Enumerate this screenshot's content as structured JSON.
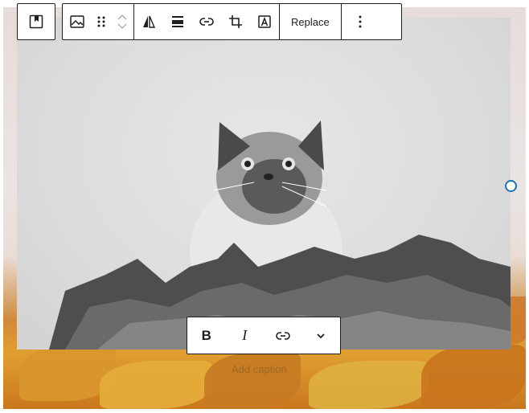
{
  "block_toolbar": {
    "block_type_icon": "cover-block-icon",
    "items": [
      {
        "name": "image-icon"
      },
      {
        "name": "drag-handle-icon"
      },
      {
        "name": "move-up-icon"
      },
      {
        "name": "move-down-icon"
      },
      {
        "name": "align-icon"
      },
      {
        "name": "wide-width-icon"
      },
      {
        "name": "link-icon"
      },
      {
        "name": "crop-icon"
      },
      {
        "name": "text-over-image-icon"
      }
    ],
    "replace_label": "Replace",
    "more_options_icon": "more-vertical-icon"
  },
  "format_toolbar": {
    "bold_label": "B",
    "italic_label": "I",
    "link_icon": "link-icon",
    "more_icon": "chevron-down-icon"
  },
  "caption": {
    "placeholder": "Add caption"
  },
  "colors": {
    "border": "#1e1e1e",
    "handle": "#1a73b8"
  }
}
